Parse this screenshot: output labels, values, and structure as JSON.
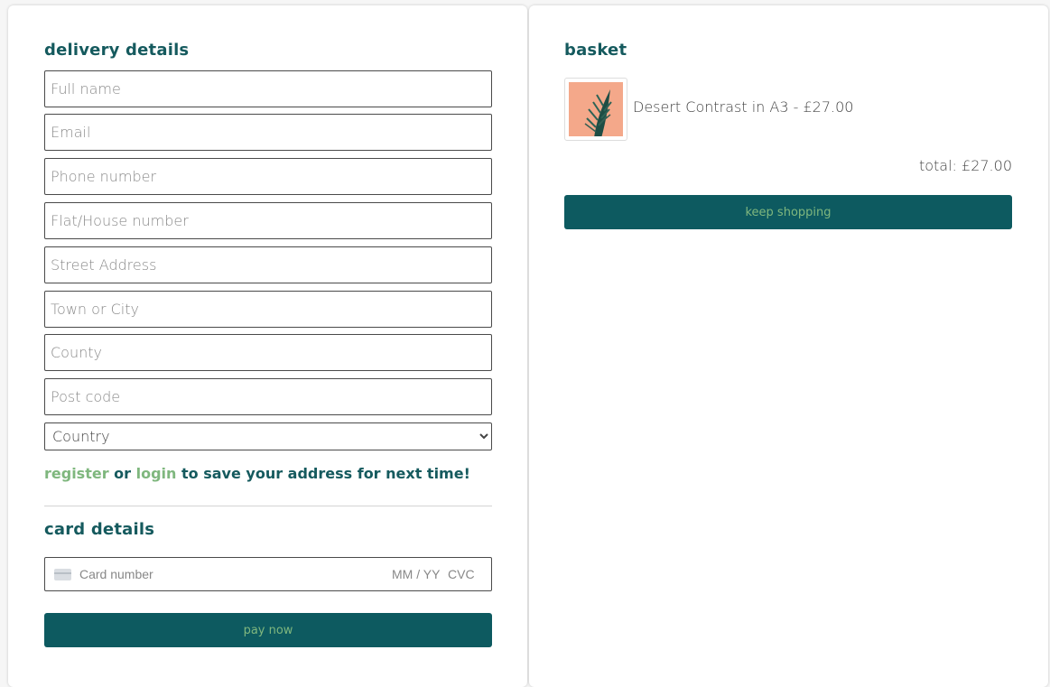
{
  "delivery": {
    "heading": "delivery details",
    "fields": {
      "full_name": "Full name",
      "email": "Email",
      "phone": "Phone number",
      "house": "Flat/House number",
      "street": "Street Address",
      "town": "Town or City",
      "county": "County",
      "postcode": "Post code"
    },
    "country_selected": "Country",
    "note": {
      "register": "register",
      "or": " or ",
      "login": "login",
      "rest": " to save your address for next time!"
    }
  },
  "card": {
    "heading": "card details",
    "number_placeholder": "Card number",
    "expiry_placeholder": "MM / YY",
    "cvc_placeholder": "CVC",
    "pay_label": "pay now"
  },
  "basket": {
    "heading": "basket",
    "items": [
      {
        "label": "Desert Contrast in A3 - £27.00"
      }
    ],
    "total": "total: £27.00",
    "keep_shopping_label": "keep shopping"
  },
  "colors": {
    "brand_teal": "#0d5a60",
    "heading_teal": "#155a5e",
    "accent_green": "#7fb77e",
    "thumb_peach": "#f4a88a"
  }
}
